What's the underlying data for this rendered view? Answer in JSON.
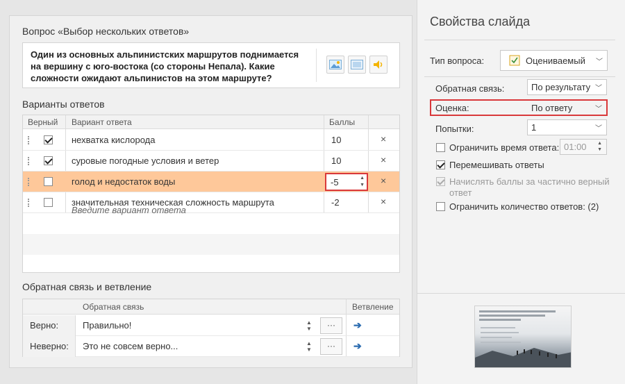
{
  "question": {
    "section_title": "Вопрос «Выбор нескольких ответов»",
    "text": "Один из основных альпинистских маршрутов поднимается на вершину с юго-востока (со стороны Непала). Какие сложности ожидают альпинистов на этом маршруте?"
  },
  "answers": {
    "section_title": "Варианты ответов",
    "headers": {
      "correct": "Верный",
      "answer": "Вариант ответа",
      "points": "Баллы"
    },
    "rows": [
      {
        "text": "нехватка кислорода",
        "points": "10",
        "correct": true
      },
      {
        "text": "суровые погодные условия и ветер",
        "points": "10",
        "correct": true
      },
      {
        "text": "голод и недостаток воды",
        "points": "-5",
        "correct": false
      },
      {
        "text": "значительная техническая сложность маршрута",
        "points": "-2",
        "correct": false
      }
    ],
    "placeholder": "Введите вариант ответа",
    "delete_glyph": "×"
  },
  "feedback": {
    "section_title": "Обратная связь и ветвление",
    "headers": {
      "feedback": "Обратная связь",
      "branching": "Ветвление"
    },
    "rows": [
      {
        "label": "Верно:",
        "text": "Правильно!"
      },
      {
        "label": "Неверно:",
        "text": "Это не совсем верно..."
      }
    ],
    "dots_label": "···"
  },
  "properties": {
    "title": "Свойства слайда",
    "question_type_label": "Тип вопроса:",
    "question_type_value": "Оцениваемый",
    "feedback_label": "Обратная связь:",
    "feedback_value": "По результату",
    "scoring_label": "Оценка:",
    "scoring_value": "По ответу",
    "attempts_label": "Попытки:",
    "attempts_value": "1",
    "limit_time_label": "Ограничить время ответа:",
    "limit_time_value": "01:00",
    "shuffle_label": "Перемешивать ответы",
    "partial_label_1": "Начислять баллы за частично верный",
    "partial_label_2": "ответ",
    "limit_answers_label": "Ограничить количество ответов: (2)"
  },
  "colors": {
    "selected_row": "#fec89a",
    "highlight": "#d9383a",
    "link_arrow": "#2b6cb0"
  }
}
